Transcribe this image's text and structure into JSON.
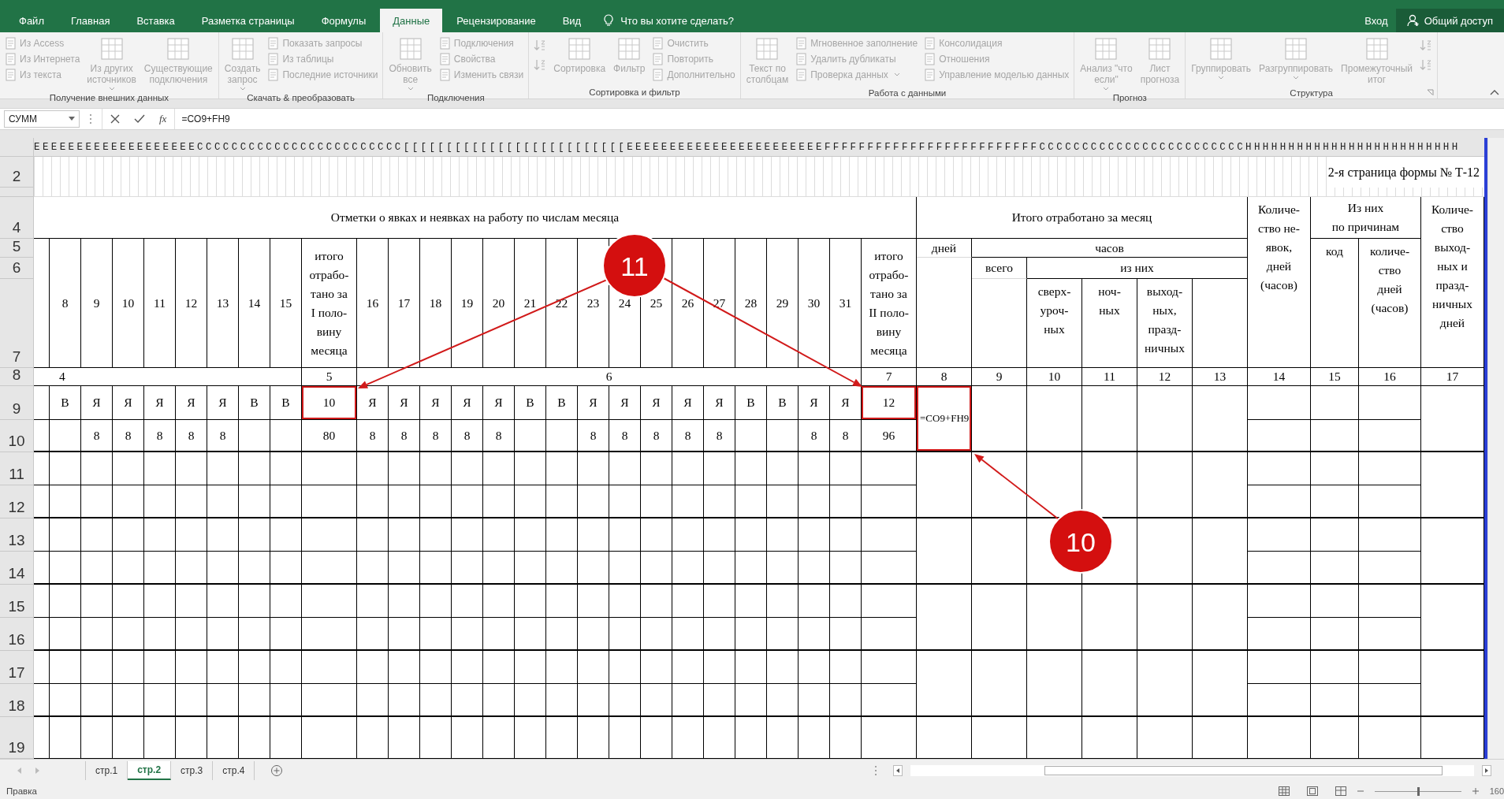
{
  "title_bar": {
    "tabs": [
      {
        "label": "Файл",
        "selected": false
      },
      {
        "label": "Главная",
        "selected": false
      },
      {
        "label": "Вставка",
        "selected": false
      },
      {
        "label": "Разметка страницы",
        "selected": false
      },
      {
        "label": "Формулы",
        "selected": false
      },
      {
        "label": "Данные",
        "selected": true
      },
      {
        "label": "Рецензирование",
        "selected": false
      },
      {
        "label": "Вид",
        "selected": false
      }
    ],
    "tell_me": {
      "placeholder": "Что вы хотите сделать?"
    },
    "sign_in": "Вход",
    "share": "Общий доступ"
  },
  "ribbon": {
    "groups": [
      {
        "label": "Получение внешних данных",
        "items": [
          {
            "kind": "small",
            "label": "Из Access",
            "disabled": true,
            "dropdown": false
          },
          {
            "kind": "small",
            "label": "Из Интернета",
            "disabled": true,
            "dropdown": false
          },
          {
            "kind": "small",
            "label": "Из текста",
            "disabled": true,
            "dropdown": false
          },
          {
            "kind": "large",
            "label": "Из других\nисточников",
            "disabled": true,
            "dropdown": true
          },
          {
            "kind": "large",
            "label": "Существующие\nподключения",
            "disabled": true,
            "dropdown": false
          }
        ]
      },
      {
        "label": "Скачать & преобразовать",
        "items": [
          {
            "kind": "large",
            "label": "Создать\nзапрос",
            "disabled": true,
            "dropdown": true
          },
          {
            "kind": "small",
            "label": "Показать запросы",
            "disabled": true,
            "dropdown": false
          },
          {
            "kind": "small",
            "label": "Из таблицы",
            "disabled": true,
            "dropdown": false
          },
          {
            "kind": "small",
            "label": "Последние источники",
            "disabled": true,
            "dropdown": false
          }
        ]
      },
      {
        "label": "Подключения",
        "items": [
          {
            "kind": "large",
            "label": "Обновить\nвсе",
            "disabled": true,
            "dropdown": true
          },
          {
            "kind": "small",
            "label": "Подключения",
            "disabled": true,
            "dropdown": false
          },
          {
            "kind": "small",
            "label": "Свойства",
            "disabled": true,
            "dropdown": false
          },
          {
            "kind": "small",
            "label": "Изменить связи",
            "disabled": true,
            "dropdown": false
          }
        ]
      },
      {
        "label": "Сортировка и фильтр",
        "items": [
          {
            "kind": "icon",
            "disabled": true
          },
          {
            "kind": "icon",
            "disabled": true
          },
          {
            "kind": "large",
            "label": "Сортировка",
            "disabled": true,
            "dropdown": false
          },
          {
            "kind": "large",
            "label": "Фильтр",
            "disabled": true,
            "dropdown": false
          },
          {
            "kind": "small",
            "label": "Очистить",
            "disabled": true,
            "dropdown": false
          },
          {
            "kind": "small",
            "label": "Повторить",
            "disabled": true,
            "dropdown": false
          },
          {
            "kind": "small",
            "label": "Дополнительно",
            "disabled": true,
            "dropdown": false
          }
        ]
      },
      {
        "label": "Работа с данными",
        "items": [
          {
            "kind": "large",
            "label": "Текст по\nстолбцам",
            "disabled": true,
            "dropdown": false
          },
          {
            "kind": "small",
            "label": "Мгновенное заполнение",
            "disabled": true,
            "dropdown": false
          },
          {
            "kind": "small",
            "label": "Удалить дубликаты",
            "disabled": true,
            "dropdown": false
          },
          {
            "kind": "small",
            "label": "Проверка данных",
            "disabled": true,
            "dropdown": true
          },
          {
            "kind": "small",
            "label": "Консолидация",
            "disabled": true,
            "dropdown": false
          },
          {
            "kind": "small",
            "label": "Отношения",
            "disabled": true,
            "dropdown": false
          },
          {
            "kind": "small",
            "label": "Управление моделью данных",
            "disabled": true,
            "dropdown": false
          }
        ]
      },
      {
        "label": "Прогноз",
        "items": [
          {
            "kind": "large",
            "label": "Анализ \"что\nесли\"",
            "disabled": true,
            "dropdown": true
          },
          {
            "kind": "large",
            "label": "Лист\nпрогноза",
            "disabled": true,
            "dropdown": false
          }
        ]
      },
      {
        "label": "Структура",
        "launcher": true,
        "items": [
          {
            "kind": "large",
            "label": "Группировать",
            "disabled": true,
            "dropdown": true
          },
          {
            "kind": "large",
            "label": "Разгруппировать",
            "disabled": true,
            "dropdown": true
          },
          {
            "kind": "large",
            "label": "Промежуточный\nитог",
            "disabled": true,
            "dropdown": false
          },
          {
            "kind": "icon",
            "disabled": true
          },
          {
            "kind": "icon",
            "disabled": true
          }
        ]
      }
    ]
  },
  "formula_bar": {
    "name_box": "СУММ",
    "fx": "fx",
    "formula": "=CO9+FH9"
  },
  "sheet": {
    "column_headers": "EEEEEEEEEEEEEEEEEEECCCCCCCCCCCCCCCCCCCCCCCC[[[[[[[[[[[[[[[[[[[[[[[[[[EEEEEEEEEEEEEEEEEEEEEEEFFFFFFFFFFFFFFFFFFFFFFFFFCCCCCCCCCCCCCCCCCCCCCCCCHHHHHHHHHHHHHHHHHHHHHHHHH",
    "row_headers": [
      "2",
      "4",
      "5",
      "6",
      "7",
      "8",
      "9",
      "10",
      "11",
      "12",
      "13",
      "14",
      "15",
      "16",
      "17",
      "18",
      "19"
    ]
  },
  "form": {
    "page_note": "2-я страница формы № Т-12",
    "attendance_title": "Отметки о явках и неявках на работу по числам месяца",
    "days_first": [
      "8",
      "9",
      "10",
      "11",
      "12",
      "13",
      "14",
      "15"
    ],
    "half1_header": "итого\nотрабо-\nтано за\nI поло-\nвину\nмесяца",
    "days_second": [
      "16",
      "17",
      "18",
      "19",
      "20",
      "21",
      "22",
      "23",
      "24",
      "25",
      "26",
      "27",
      "28",
      "29",
      "30",
      "31"
    ],
    "half2_header": "итого\nотрабо-\nтано за\nII поло-\nвину\nмесяца",
    "total_title": "Итого отработано за месяц",
    "days_label": "дней",
    "hours_label": "часов",
    "all_label": "всего",
    "of_them_label": "из них",
    "overtime_header": "сверх-\nуроч-\nных",
    "night_header": "ноч-\nных",
    "holiday_header": "выход-\nных,\nпразд-\nничных",
    "absence_header": "Количе-\nство не-\nявок,\nдней\n(часов)",
    "reasons_title": "Из них\nпо причинам",
    "code_header": "код",
    "reason_days_header": "количе-\nство\nдней\n(часов)",
    "days_off_header": "Количе-\nство\nвыход-\nных и\nпразд-\nничных\nдней",
    "column_numbers": [
      "4",
      "5",
      "6",
      "7",
      "8",
      "9",
      "10",
      "11",
      "12",
      "13",
      "14",
      "15",
      "16",
      "17"
    ],
    "marks_first": [
      "В",
      "Я",
      "Я",
      "Я",
      "Я",
      "Я",
      "В",
      "В"
    ],
    "half1_days": {
      "value": "10",
      "highlighted": true
    },
    "marks_second": [
      "Я",
      "Я",
      "Я",
      "Я",
      "Я",
      "В",
      "В",
      "Я",
      "Я",
      "Я",
      "Я",
      "Я",
      "В",
      "В",
      "Я",
      "Я"
    ],
    "half2_days": {
      "value": "12",
      "highlighted": true
    },
    "hours_first": [
      {
        "kind": "empty"
      },
      {
        "kind": "value",
        "value": "8"
      },
      {
        "kind": "value",
        "value": "8"
      },
      {
        "kind": "value",
        "value": "8"
      },
      {
        "kind": "value",
        "value": "8"
      },
      {
        "kind": "value",
        "value": "8"
      },
      {
        "kind": "empty"
      },
      {
        "kind": "empty"
      }
    ],
    "half1_hours": "80",
    "hours_second": [
      {
        "kind": "value",
        "value": "8"
      },
      {
        "kind": "value",
        "value": "8"
      },
      {
        "kind": "value",
        "value": "8"
      },
      {
        "kind": "value",
        "value": "8"
      },
      {
        "kind": "value",
        "value": "8"
      },
      {
        "kind": "empty"
      },
      {
        "kind": "empty"
      },
      {
        "kind": "value",
        "value": "8"
      },
      {
        "kind": "value",
        "value": "8"
      },
      {
        "kind": "value",
        "value": "8"
      },
      {
        "kind": "value",
        "value": "8"
      },
      {
        "kind": "value",
        "value": "8"
      },
      {
        "kind": "empty"
      },
      {
        "kind": "empty"
      },
      {
        "kind": "value",
        "value": "8"
      },
      {
        "kind": "value",
        "value": "8"
      }
    ],
    "half2_hours": "96",
    "days_total": {
      "formula": "=CO9+FH9",
      "highlighted": true
    }
  },
  "callouts": [
    {
      "label": "11"
    },
    {
      "label": "10"
    }
  ],
  "sheet_tabs": [
    {
      "label": "стр.1",
      "selected": false
    },
    {
      "label": "стр.2",
      "selected": true
    },
    {
      "label": "стр.3",
      "selected": false
    },
    {
      "label": "стр.4",
      "selected": false
    }
  ],
  "status_bar": {
    "mode": "Правка",
    "zoom": {
      "level": 0.5,
      "reading": "160"
    }
  }
}
